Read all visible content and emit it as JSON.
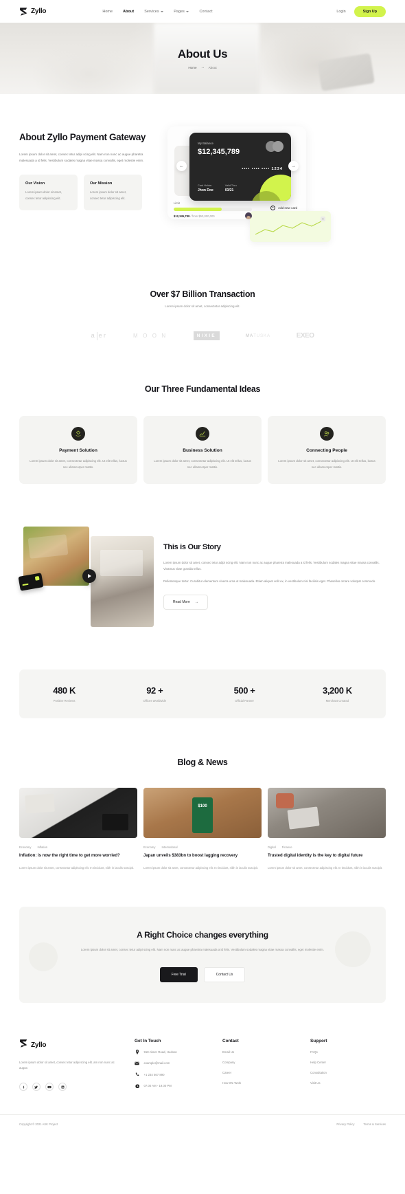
{
  "nav": {
    "brand": "Zyllo",
    "links": [
      {
        "label": "Home",
        "dropdown": false,
        "active": false
      },
      {
        "label": "About",
        "dropdown": false,
        "active": true
      },
      {
        "label": "Services",
        "dropdown": true,
        "active": false
      },
      {
        "label": "Pages",
        "dropdown": true,
        "active": false
      },
      {
        "label": "Contact",
        "dropdown": false,
        "active": false
      }
    ],
    "login": "Login",
    "signup": "Sign Up"
  },
  "hero": {
    "title": "About Us",
    "crumb_home": "Home",
    "crumb_arrow": "→",
    "crumb_current": "About"
  },
  "about": {
    "title": "About Zyllo Payment Gateway",
    "desc": "Lorem ipsum dolor sit amet, consec tetur adipi scing elit. Nam non nunc ac augue pharetra malesuada a id felis. Vestibulum sodales magna vitae massa convallis, eget molestie enim.",
    "cards": [
      {
        "title": "Our Vision",
        "text": "Lorem ipsum dolor sit amet, consec tetur adipiscing elit."
      },
      {
        "title": "Our Mission",
        "text": "Lorem ipsum dolor sit amet, consec tetur adipiscing elit."
      }
    ]
  },
  "card_widget": {
    "balance_label": "My Balance",
    "balance": "$12,345,789",
    "card_number": "•••• •••• •••• 1234",
    "holder_label": "Card Holder",
    "holder_value": "Jhon Doe",
    "valid_label": "Valid Thru",
    "valid_value": "03/21",
    "limit_label": "Limit",
    "limit_used": "$12,345,789",
    "limit_total": "/ from $50,000,000",
    "add_card": "Add new card",
    "prev_arrow": "←",
    "next_arrow": "→",
    "plus": "+",
    "close": "×"
  },
  "transaction": {
    "title": "Over $7 Billion Transaction",
    "subtitle": "Lorem ipsum dolor sit amet, consectetur adipiscing elit.",
    "logos": [
      {
        "name": "aller",
        "a": "a",
        "b": "e",
        "c": "r"
      },
      {
        "name": "MOON",
        "text": "M O O N"
      },
      {
        "name": "NIXIE",
        "text": "NIXIE"
      },
      {
        "name": "MATUSKA",
        "bold": "MA",
        "light": "TUSKA"
      },
      {
        "name": "EXEO",
        "text": "EXEO"
      }
    ]
  },
  "ideas": {
    "title": "Our Three Fundamental Ideas",
    "cards": [
      {
        "icon": "payment-icon",
        "title": "Payment Solution",
        "text": "Lorem ipsum dolor sit amet, consectetur adipiscing elit. Ut elit tellus, luctus nec ullamcorper mattis."
      },
      {
        "icon": "chart-icon",
        "title": "Business Solution",
        "text": "Lorem ipsum dolor sit amet, consectetur adipiscing elit. Ut elit tellus, luctus nec ullamcorper mattis."
      },
      {
        "icon": "people-icon",
        "title": "Connecting People",
        "text": "Lorem ipsum dolor sit amet, consectetur adipiscing elit. Ut elit tellus, luctus nec ullamcorper mattis."
      }
    ]
  },
  "story": {
    "title": "This is Our Story",
    "p1": "Lorem ipsum dolor sit amet, consec tetur adipi scing elit. Nam non nunc ac augue pharetra malesuada a id felis. Vestibulum sodales magna vitae massa convallis. Vivamus vitae gravida tellus.",
    "p2": "Pellentesque tortor. Curabitur elementum viverra urna ut malesuada. Etiam aliquet velit ex, in vestibulum nisi facilisis eget. Phasellus ornare volutpat commodo.",
    "read_more": "Read More",
    "read_more_arrow": "→"
  },
  "stats": [
    {
      "number": "480 K",
      "label": "Positive Reviews"
    },
    {
      "number": "92 +",
      "label": "Offices Worldwide"
    },
    {
      "number": "500 +",
      "label": "Official Partner"
    },
    {
      "number": "3,200 K",
      "label": "Merchant Created"
    }
  ],
  "blog": {
    "title": "Blog & News",
    "posts": [
      {
        "tag1": "Economy",
        "tag2": "Inflation",
        "headline": "Inflation: is now the right time to get more worried?",
        "excerpt": "Lorem ipsum dolor sit amet, consectetur adipiscing elit. In tincidunt, nibh in iaculis suscipit."
      },
      {
        "tag1": "Economy",
        "tag2": "International",
        "headline": "Japan unveils $383bn to boost lagging recovery",
        "excerpt": "Lorem ipsum dolor sit amet, consectetur adipiscing elit. In tincidunt, nibh in iaculis suscipit.",
        "image_amount": "$100"
      },
      {
        "tag1": "Digital",
        "tag2": "Finance",
        "headline": "Trusted digital identity is the key to digital future",
        "excerpt": "Lorem ipsum dolor sit amet, consectetur adipiscing elit. In tincidunt, nibh in iaculis suscipit."
      }
    ]
  },
  "cta": {
    "title": "A Right Choice changes everything",
    "text": "Lorem ipsum dolor sit amet, consec tetur adipi scing elit. Nam non nunc ac augue pharetra malesuada a id felis. Vestibulum sodales magna vitae massa convallis, eget molestie enim.",
    "primary": "Free Trial",
    "secondary": "Contact Us"
  },
  "footer": {
    "brand": "Zyllo",
    "desc": "Lorem ipsum dolor sit amet, consec tetur adipi scing elit. am non nunc ac augue.",
    "socials": [
      "facebook-icon",
      "twitter-icon",
      "youtube-icon",
      "linkedin-icon"
    ],
    "get_in_touch": {
      "title": "Get In Touch",
      "items": [
        {
          "icon": "location-icon",
          "text": "918 Abner Road, Hudson"
        },
        {
          "icon": "mail-icon",
          "text": "example@mail.com"
        },
        {
          "icon": "phone-icon",
          "text": "+1 234 567 890"
        },
        {
          "icon": "clock-icon",
          "text": "07.00 AM - 19.00 PM"
        }
      ]
    },
    "contact": {
      "title": "Contact",
      "links": [
        "Email Us",
        "Company",
        "Career",
        "How We Work"
      ]
    },
    "support": {
      "title": "Support",
      "links": [
        "FAQs",
        "Help Center",
        "Consultation",
        "Visit Us"
      ]
    },
    "copyright": "Copyright © 2021 ASK Project",
    "bottom_links": [
      "Privacy Policy",
      "Terms & Services"
    ]
  },
  "colors": {
    "accent": "#d2f34c",
    "dark": "#19191c",
    "muted": "#8c8c8c",
    "panel": "#f4f4f2"
  }
}
